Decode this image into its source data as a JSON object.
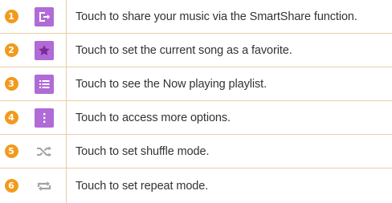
{
  "rows": [
    {
      "number": "1",
      "icon": "share-icon",
      "text": "Touch to share your music via the SmartShare function."
    },
    {
      "number": "2",
      "icon": "star-icon",
      "text": "Touch to set the current song as a favorite."
    },
    {
      "number": "3",
      "icon": "playlist-icon",
      "text": "Touch to see the Now playing playlist."
    },
    {
      "number": "4",
      "icon": "more-options-icon",
      "text": "Touch to access more options."
    },
    {
      "number": "5",
      "icon": "shuffle-icon",
      "text": "Touch to set shuffle mode."
    },
    {
      "number": "6",
      "icon": "repeat-icon",
      "text": "Touch to set repeat mode."
    }
  ],
  "colors": {
    "number_badge": "#f29a1c",
    "icon_bg": "#b06bd6",
    "icon_grey": "#a3a3a3",
    "border": "#e6cfa6"
  }
}
